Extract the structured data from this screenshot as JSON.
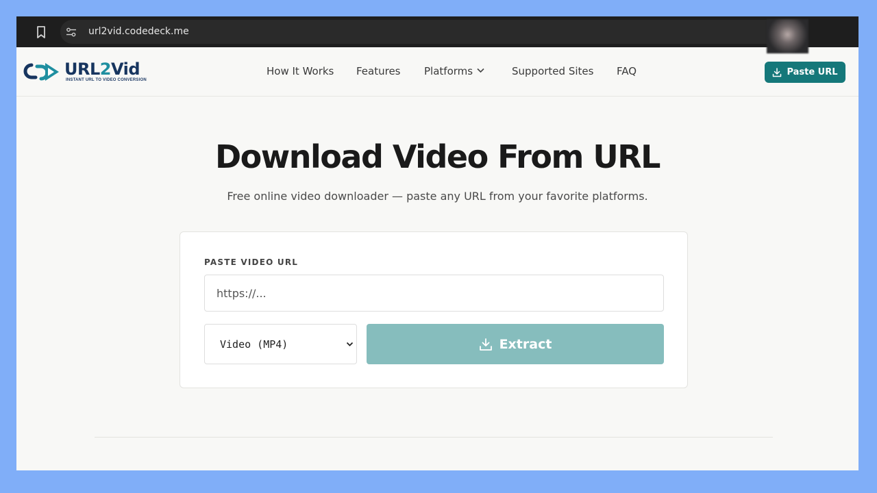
{
  "browser": {
    "url": "url2vid.codedeck.me",
    "icons": [
      "bookmark-icon",
      "site-settings-icon"
    ]
  },
  "brand": {
    "name_prefix": "URL",
    "name_digit": "2",
    "name_suffix": "Vid",
    "tagline": "INSTANT URL TO VIDEO CONVERSION",
    "colors": {
      "navy": "#17355f",
      "teal": "#1f8fa0"
    }
  },
  "nav": {
    "items": [
      {
        "label": "How It Works"
      },
      {
        "label": "Features"
      },
      {
        "label": "Platforms",
        "has_dropdown": true
      },
      {
        "label": "Supported Sites"
      },
      {
        "label": "FAQ"
      }
    ],
    "cta_label": "Paste URL",
    "cta_color": "#15787a"
  },
  "hero": {
    "title": "Download Video From URL",
    "subtitle": "Free online video downloader — paste any URL from your favorite platforms."
  },
  "form": {
    "label": "PASTE VIDEO URL",
    "url_placeholder": "https://...",
    "url_value": "",
    "format_selected": "Video (MP4)",
    "extract_label": "Extract",
    "extract_color": "#86bdbd"
  }
}
